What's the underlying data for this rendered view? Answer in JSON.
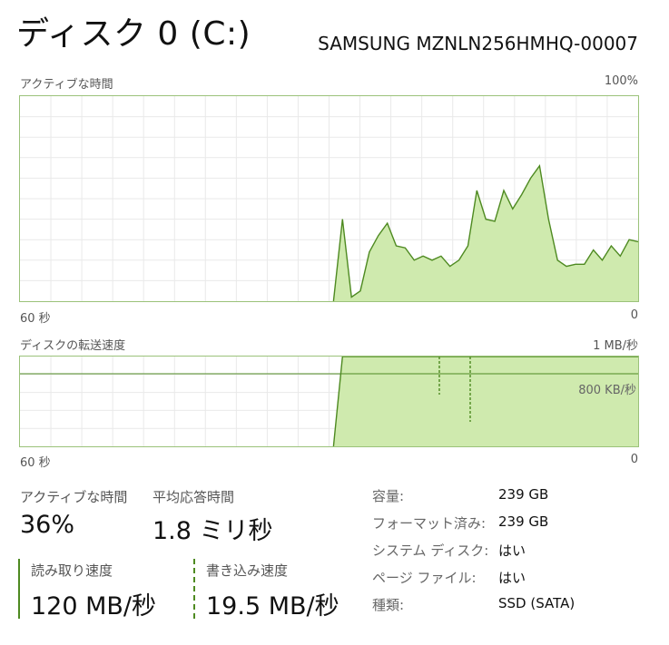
{
  "header": {
    "title": "ディスク 0 (C:)",
    "model": "SAMSUNG MZNLN256HMHQ-00007"
  },
  "active_time_graph": {
    "label": "アクティブな時間",
    "max_label": "100%",
    "time_left": "60 秒",
    "time_right": "0",
    "series_percent": [
      0,
      0,
      0,
      0,
      0,
      0,
      0,
      0,
      0,
      0,
      0,
      0,
      0,
      0,
      0,
      0,
      0,
      0,
      0,
      0,
      0,
      0,
      0,
      0,
      0,
      0,
      0,
      0,
      0,
      0,
      0,
      0,
      0,
      0,
      0,
      0,
      40,
      2,
      5,
      24,
      32,
      38,
      27,
      26,
      20,
      22,
      20,
      22,
      17,
      20,
      27,
      54,
      40,
      39,
      54,
      45,
      52,
      60,
      66,
      40,
      20,
      17,
      18,
      18,
      25,
      20,
      27,
      22,
      30,
      29
    ]
  },
  "transfer_graph": {
    "label": "ディスクの転送速度",
    "max_label": "1 MB/秒",
    "ref_label": "800 KB/秒",
    "time_left": "60 秒",
    "time_right": "0",
    "series_percent": [
      0,
      0,
      0,
      0,
      0,
      0,
      0,
      0,
      0,
      0,
      0,
      0,
      0,
      0,
      0,
      0,
      0,
      0,
      0,
      0,
      0,
      0,
      0,
      0,
      0,
      0,
      0,
      0,
      0,
      0,
      0,
      0,
      0,
      0,
      0,
      0,
      100,
      100,
      100,
      100,
      100,
      100,
      100,
      100,
      100,
      100,
      100,
      100,
      100,
      100,
      100,
      100,
      100,
      100,
      100,
      100,
      100,
      100,
      100,
      100,
      100,
      100,
      100,
      100,
      100,
      100,
      100,
      100,
      100,
      100
    ]
  },
  "stats": {
    "active_time": {
      "label": "アクティブな時間",
      "value": "36%"
    },
    "avg_response": {
      "label": "平均応答時間",
      "value": "1.8 ミリ秒"
    },
    "read_speed": {
      "label": "読み取り速度",
      "value": "120 MB/秒"
    },
    "write_speed": {
      "label": "書き込み速度",
      "value": "19.5 MB/秒"
    }
  },
  "info": [
    {
      "label": "容量:",
      "value": "239 GB"
    },
    {
      "label": "フォーマット済み:",
      "value": "239 GB"
    },
    {
      "label": "システム ディスク:",
      "value": "はい"
    },
    {
      "label": "ページ ファイル:",
      "value": "はい"
    },
    {
      "label": "種類:",
      "value": "SSD (SATA)"
    }
  ],
  "colors": {
    "accent_line": "#4e8a21",
    "fill": "#cfeaae",
    "border": "#9bc27a",
    "grid": "#e9e9e9"
  }
}
